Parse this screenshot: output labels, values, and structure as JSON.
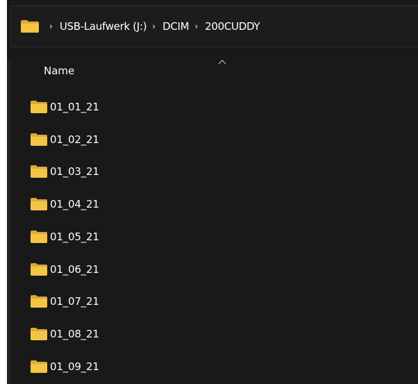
{
  "address_bar": {
    "icon": "folder-icon",
    "breadcrumbs": [
      "USB-Laufwerk (J:)",
      "DCIM",
      "200CUDDY"
    ],
    "separator": "›"
  },
  "file_list": {
    "column_header": "Name",
    "sort_indicator": "chevron-up-icon",
    "items": [
      {
        "name": "01_01_21",
        "icon": "folder-icon"
      },
      {
        "name": "01_02_21",
        "icon": "folder-icon"
      },
      {
        "name": "01_03_21",
        "icon": "folder-icon"
      },
      {
        "name": "01_04_21",
        "icon": "folder-icon"
      },
      {
        "name": "01_05_21",
        "icon": "folder-icon"
      },
      {
        "name": "01_06_21",
        "icon": "folder-icon"
      },
      {
        "name": "01_07_21",
        "icon": "folder-icon"
      },
      {
        "name": "01_08_21",
        "icon": "folder-icon"
      },
      {
        "name": "01_09_21",
        "icon": "folder-icon"
      }
    ]
  },
  "colors": {
    "background": "#191919",
    "folder": "#f4c542",
    "folder_dark": "#dca93a",
    "text": "#ffffff"
  }
}
